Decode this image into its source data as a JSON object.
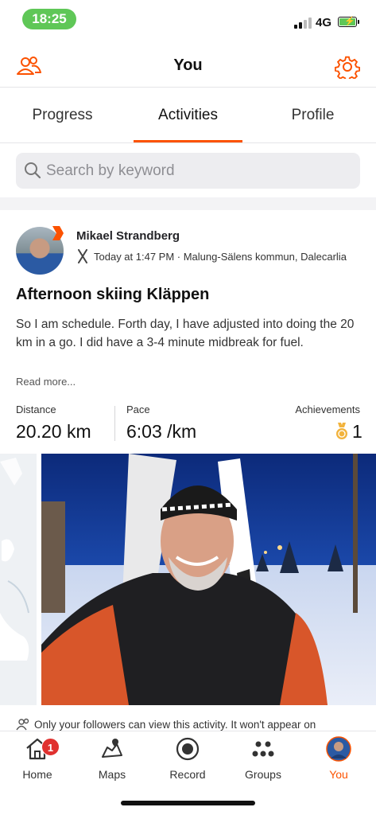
{
  "status_bar": {
    "time": "18:25",
    "network": "4G"
  },
  "header": {
    "title": "You",
    "left_icon": "people-icon",
    "right_icon": "gear-icon"
  },
  "tabs": [
    {
      "label": "Progress",
      "active": false
    },
    {
      "label": "Activities",
      "active": true
    },
    {
      "label": "Profile",
      "active": false
    }
  ],
  "search": {
    "placeholder": "Search by keyword",
    "value": ""
  },
  "activity": {
    "athlete": "Mikael Strandberg",
    "meta": "Today at 1:47 PM · Malung-Sälens kommun, Dalecarlia",
    "title": "Afternoon skiing Kläppen",
    "description": "So I am schedule. Forth day, I have adjusted into doing the 20 km in a go. I did have a 3-4 minute midbreak for fuel.",
    "read_more": "Read more...",
    "stats": {
      "distance_label": "Distance",
      "distance_value": "20.20 km",
      "pace_label": "Pace",
      "pace_value": "6:03 /km",
      "achievements_label": "Achievements",
      "achievements_value": "1"
    },
    "privacy_note": "Only your followers can view this activity. It won't appear on"
  },
  "bottom_nav": [
    {
      "label": "Home",
      "icon": "home-icon",
      "badge": "1",
      "active": false
    },
    {
      "label": "Maps",
      "icon": "map-icon",
      "active": false
    },
    {
      "label": "Record",
      "icon": "record-icon",
      "active": false
    },
    {
      "label": "Groups",
      "icon": "groups-icon",
      "active": false
    },
    {
      "label": "You",
      "icon": "avatar-icon",
      "active": true
    }
  ],
  "colors": {
    "accent": "#fc5200",
    "status_pill": "#5fc757",
    "badge": "#e0312f"
  }
}
